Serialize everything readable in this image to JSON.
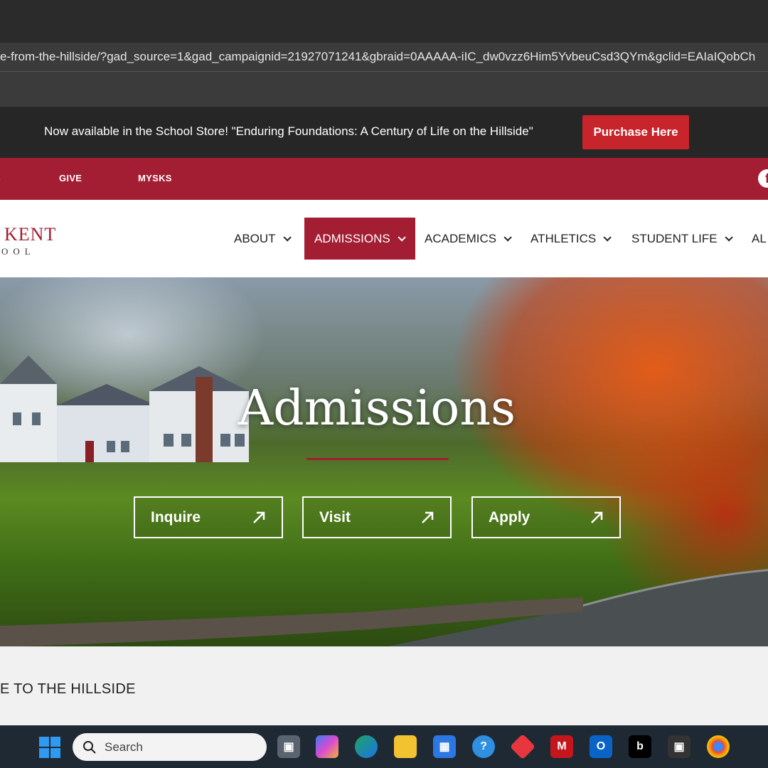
{
  "browser": {
    "url": "e-from-the-hillside/?gad_source=1&gad_campaignid=21927071241&gbraid=0AAAAA-iIC_dw0vzz6Him5YvbeuCsd3QYm&gclid=EAIaIQobCh"
  },
  "announcement": {
    "text": "Now available in the School Store! \"Enduring Foundations: A Century of Life on the Hillside\"",
    "button_label": "Purchase Here"
  },
  "utility_nav": {
    "partial_left": "S",
    "items": [
      "GIVE",
      "MYSKS"
    ],
    "social_icon": "facebook-icon"
  },
  "logo": {
    "name": "KENT",
    "subline": "OOL"
  },
  "main_nav": {
    "items": [
      {
        "label": "ABOUT"
      },
      {
        "label": "ADMISSIONS"
      },
      {
        "label": "ACADEMICS"
      },
      {
        "label": "ATHLETICS"
      },
      {
        "label": "STUDENT LIFE"
      },
      {
        "label": "AL"
      }
    ],
    "active": "ADMISSIONS"
  },
  "hero": {
    "title": "Admissions",
    "buttons": [
      "Inquire",
      "Visit",
      "Apply"
    ],
    "accent_color": "#a31d33"
  },
  "content": {
    "heading_partial": "E TO THE HILLSIDE"
  },
  "taskbar": {
    "search_placeholder": "Search",
    "icons": [
      "windows-start-icon",
      "task-view-icon",
      "copilot-icon",
      "edge-icon",
      "file-explorer-icon",
      "microsoft-store-icon",
      "help-icon",
      "office-icon",
      "mcafee-icon",
      "outlook-icon",
      "bing-icon",
      "app-icon",
      "chrome-icon"
    ]
  },
  "colors": {
    "brand_red": "#a31d33",
    "cta_red": "#c8242b",
    "announcement_bg": "#262626"
  }
}
